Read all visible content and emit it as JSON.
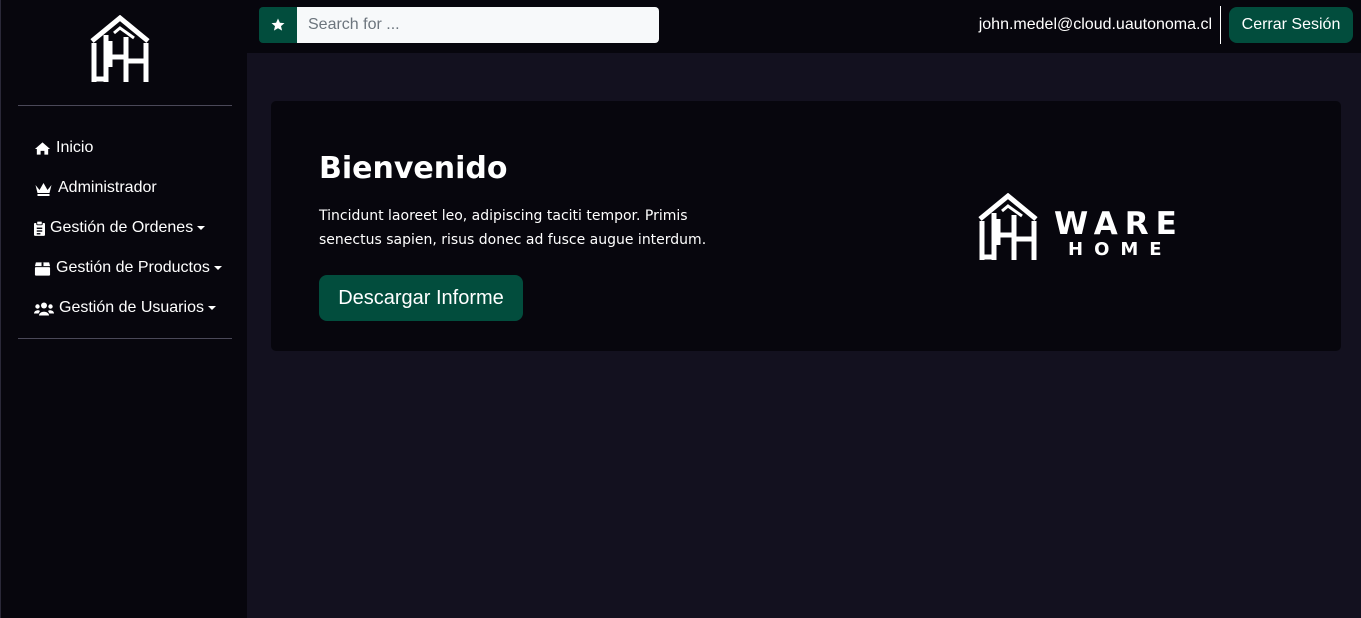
{
  "colors": {
    "accent": "#024d3d",
    "sidebar_bg": "#07060d",
    "main_bg": "#13111f",
    "card_bg": "#07060d"
  },
  "sidebar": {
    "logo_icon": "warehome-logo-icon",
    "items": [
      {
        "label": "Inicio",
        "icon": "home-icon"
      },
      {
        "label": "Administrador",
        "icon": "crown-icon"
      },
      {
        "label": "Gestión de Ordenes",
        "icon": "clipboard-icon"
      },
      {
        "label": "Gestión de Productos",
        "icon": "box-icon"
      },
      {
        "label": "Gestión de Usuarios",
        "icon": "users-icon"
      }
    ]
  },
  "topbar": {
    "search_icon": "star-icon",
    "search_placeholder": "Search for ...",
    "user_email": "john.medel@cloud.uautonoma.cl",
    "logout_label": "Cerrar Sesión"
  },
  "main": {
    "title": "Bienvenido",
    "description": "Tincidunt laoreet leo, adipiscing taciti tempor. Primis senectus sapien, risus donec ad fusce augue interdum.",
    "button_label": "Descargar Informe",
    "brand_line1": "WARE",
    "brand_line2": "HOME"
  }
}
